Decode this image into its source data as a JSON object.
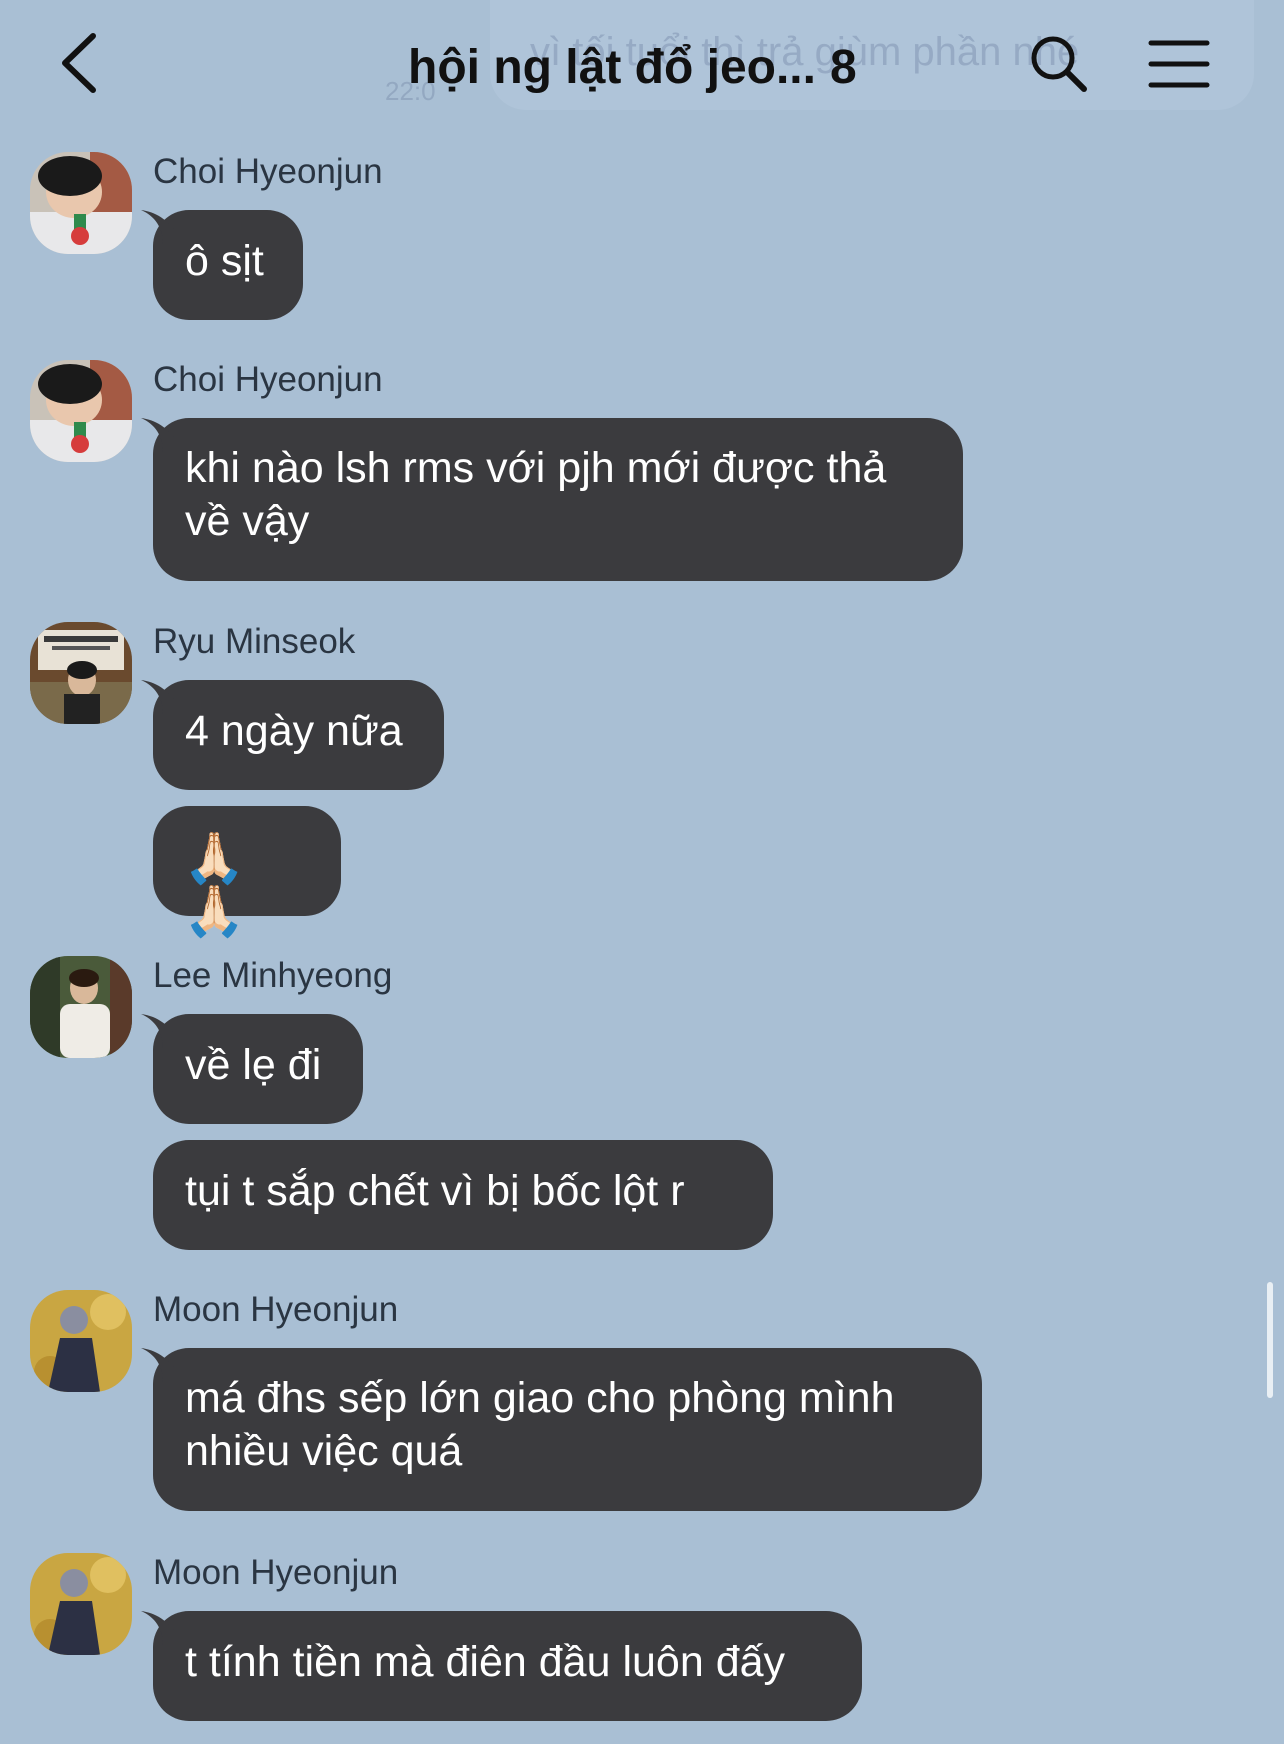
{
  "header": {
    "title": "hội ng lật đổ jeo...",
    "member_count": "8",
    "ghost_banner_text": "vì tối tuổi thì trả giùm phần nhé",
    "ghost_time": "22:0"
  },
  "icons": {
    "back": "chevron-left-icon",
    "search": "search-icon",
    "menu": "hamburger-menu-icon"
  },
  "messages": [
    {
      "sender": "Choi Hyeonjun",
      "bubbles": [
        {
          "lines": [
            "ô sịt"
          ]
        }
      ]
    },
    {
      "sender": "Choi Hyeonjun",
      "bubbles": [
        {
          "lines": [
            "khi nào lsh rms với pjh mới được thả",
            "về vậy"
          ]
        }
      ]
    },
    {
      "sender": "Ryu Minseok",
      "bubbles": [
        {
          "lines": [
            "4 ngày nữa"
          ]
        },
        {
          "lines": [
            "🙏🏻🙏🏻"
          ]
        }
      ]
    },
    {
      "sender": "Lee Minhyeong",
      "bubbles": [
        {
          "lines": [
            "về lẹ đi"
          ]
        },
        {
          "lines": [
            "tụi t sắp chết vì bị bốc lột r"
          ]
        }
      ]
    },
    {
      "sender": "Moon Hyeonjun",
      "bubbles": [
        {
          "lines": [
            "má đhs sếp lớn giao cho phòng mình",
            "nhiều việc quá"
          ]
        }
      ]
    },
    {
      "sender": "Moon Hyeonjun",
      "bubbles": [
        {
          "lines": [
            "t tính tiền mà điên đầu luôn đấy"
          ]
        }
      ]
    }
  ],
  "colors": {
    "background": "#a9bfd4",
    "bubble": "#3b3b3e",
    "bubble_text": "#ffffff",
    "sender_text": "#2a3542"
  }
}
